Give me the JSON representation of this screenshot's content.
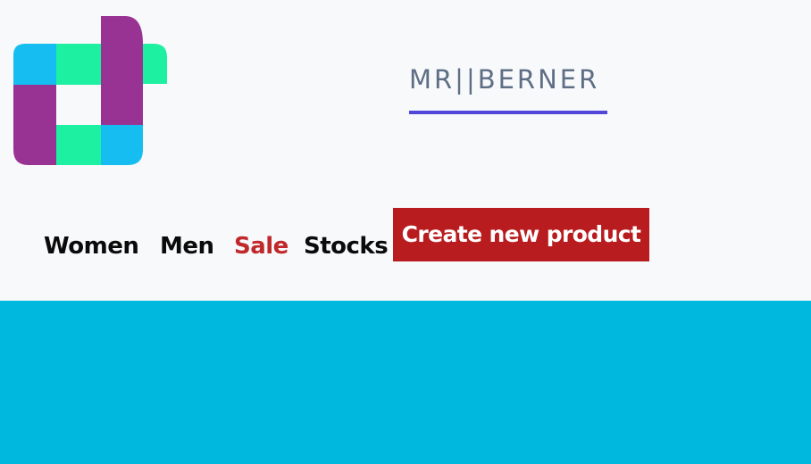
{
  "brand": {
    "name": "MR||BERNER",
    "accent_color": "#5147d8",
    "text_color": "#5d6e85"
  },
  "logo": {
    "icon": "app-logo-icon",
    "colors": [
      "#16bdf0",
      "#1ef0a2",
      "#983394"
    ]
  },
  "nav": {
    "items": [
      {
        "label": "Women"
      },
      {
        "label": "Men"
      },
      {
        "label": "Sale"
      },
      {
        "label": "Stocks"
      }
    ],
    "sale_color": "#c0282a"
  },
  "create_button": {
    "label": "Create new product",
    "color": "#b91c1f"
  },
  "colors": {
    "header_background": "#f8f9fb",
    "main_background": "#00b8de"
  }
}
